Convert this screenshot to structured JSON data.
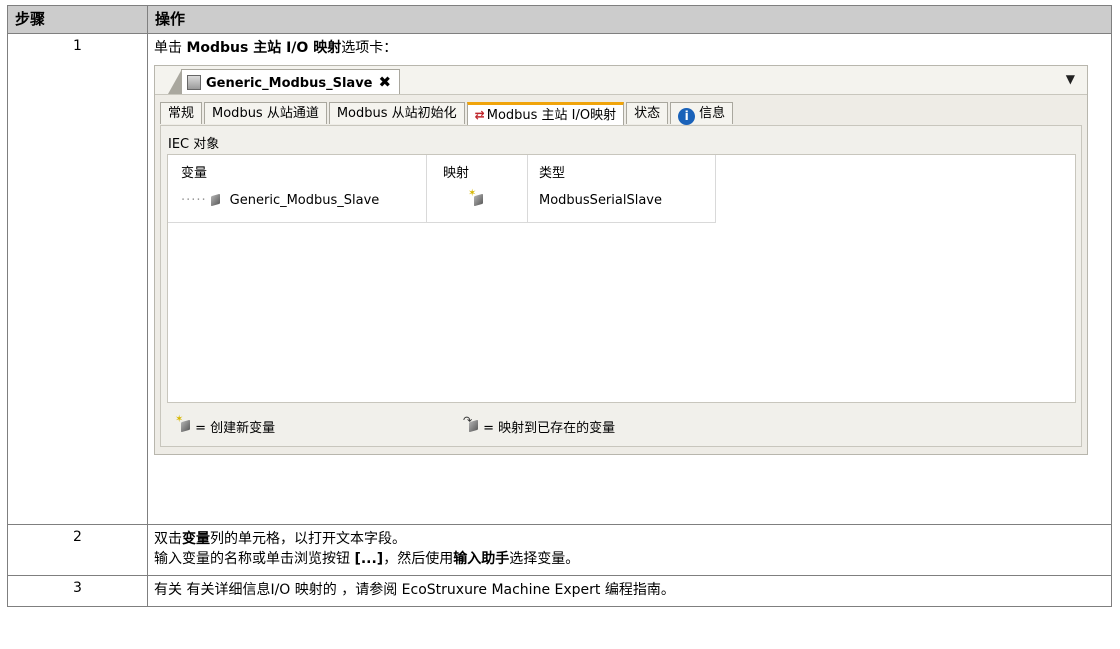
{
  "table": {
    "header": {
      "step": "步骤",
      "action": "操作"
    },
    "rows": [
      {
        "num": "1",
        "text_a": "单击 ",
        "text_b": "Modbus 主站 I/O 映射",
        "text_c": "选项卡："
      },
      {
        "num": "2",
        "line1_a": "双击",
        "line1_b": "变量",
        "line1_c": "列的单元格，以打开文本字段。",
        "line2_a": "输入变量的名称或单击浏览按钮 ",
        "line2_b": "[...]",
        "line2_c": "，然后使用",
        "line2_d": "输入助手",
        "line2_e": "选择变量。"
      },
      {
        "num": "3",
        "text": "有关 有关详细信息I/O 映射的 ，请参阅 EcoStruxure Machine Expert 编程指南。"
      }
    ]
  },
  "screenshot": {
    "doc_tab": {
      "label": "Generic_Modbus_Slave",
      "close": "✖"
    },
    "dropdown": "▼",
    "tabs": [
      "常规",
      "Modbus 从站通道",
      "Modbus 从站初始化",
      "Modbus 主站 I/O映射",
      "状态",
      "信息"
    ],
    "panel_title": "IEC 对象",
    "columns": {
      "variable": "变量",
      "mapping": "映射",
      "type": "类型"
    },
    "row": {
      "variable": "Generic_Modbus_Slave",
      "type": "ModbusSerialSlave"
    },
    "legend": {
      "create": "= 创建新变量",
      "map": "= 映射到已存在的变量"
    }
  }
}
